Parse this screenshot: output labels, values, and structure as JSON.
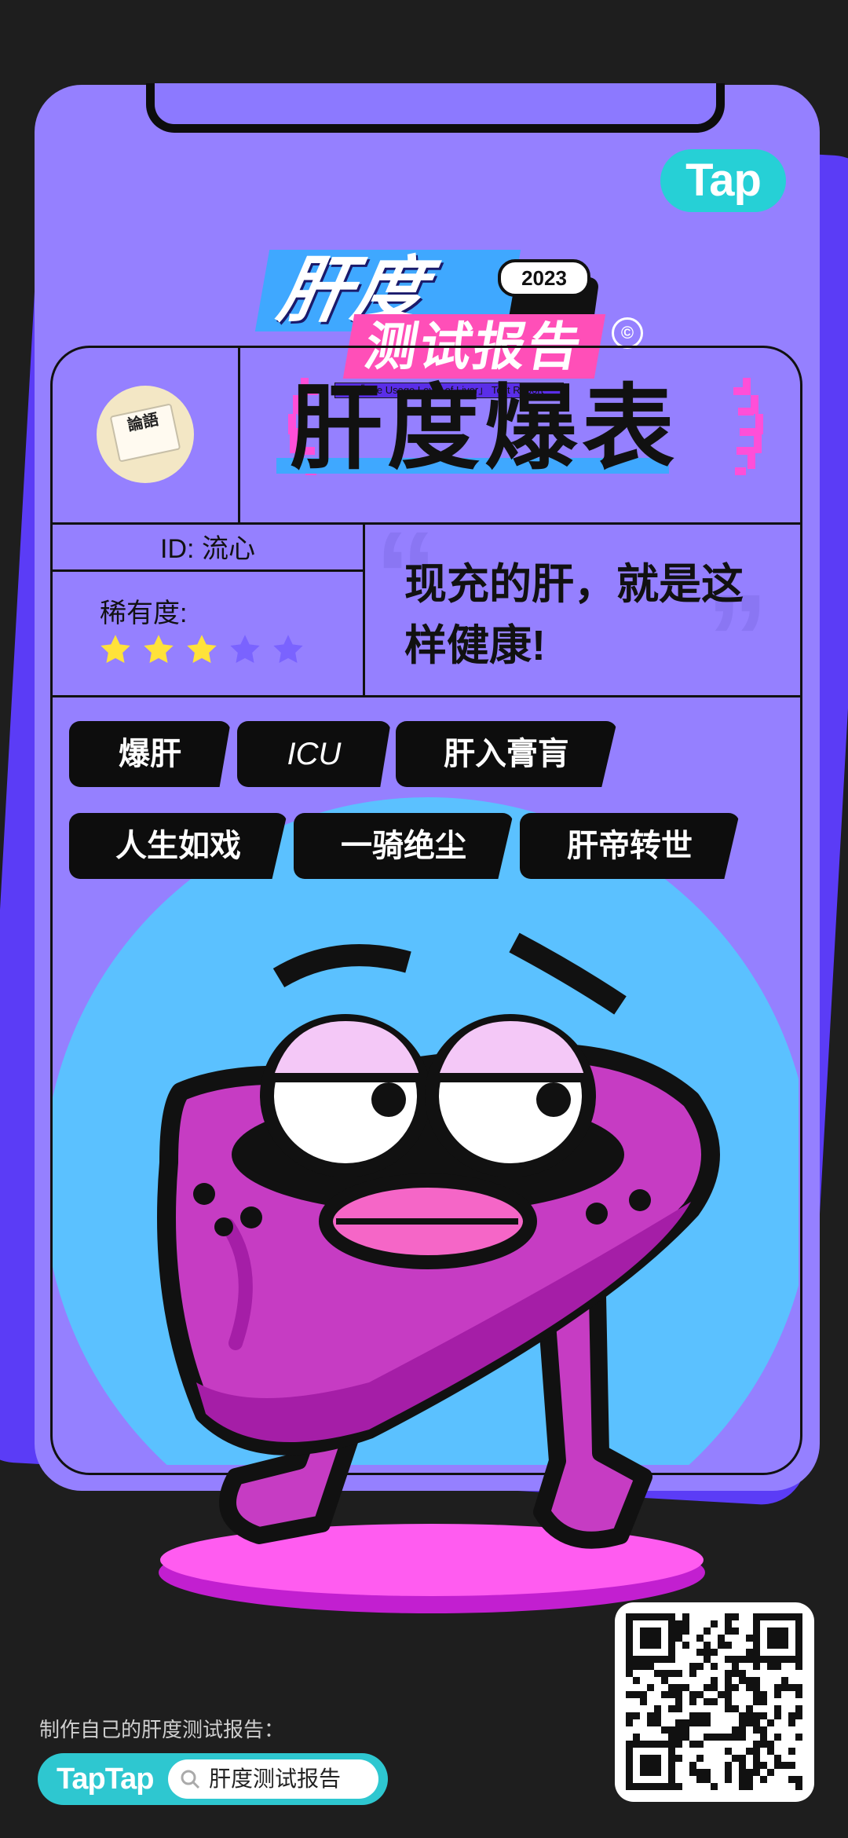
{
  "brand": {
    "tap_logo": "Tap",
    "taptap": "TapTap"
  },
  "title": {
    "line1": "肝度",
    "year": "2023",
    "line2": "测试报告",
    "mark": "©",
    "subtitle": "「The Usage Level of Liver」 Test Report"
  },
  "avatar": {
    "book_text": "論語"
  },
  "rank": "肝度爆表",
  "profile": {
    "id": "ID: 流心",
    "rarity_label": "稀有度:",
    "rarity_stars": 3,
    "rarity_max": 5
  },
  "quote": {
    "line1": "现充的肝，就是这",
    "line2": "样健康!",
    "open_mark": "“",
    "close_mark": "”"
  },
  "tags": [
    "爆肝",
    "ICU",
    "肝入膏肓",
    "人生如戏",
    "一骑绝尘",
    "肝帝转世"
  ],
  "footer": {
    "label": "制作自己的肝度测试报告：",
    "search_text": "肝度测试报告"
  },
  "colors": {
    "background": "#1e1e1e",
    "card": "#9580ff",
    "card_back": "#5b3cf6",
    "accent_cyan": "#26d0d6",
    "accent_pink": "#ff4fb8",
    "accent_blue": "#3fa8ff",
    "liver": "#c63cc3",
    "star_on": "#ffe23a",
    "star_off": "#7a63ff"
  }
}
